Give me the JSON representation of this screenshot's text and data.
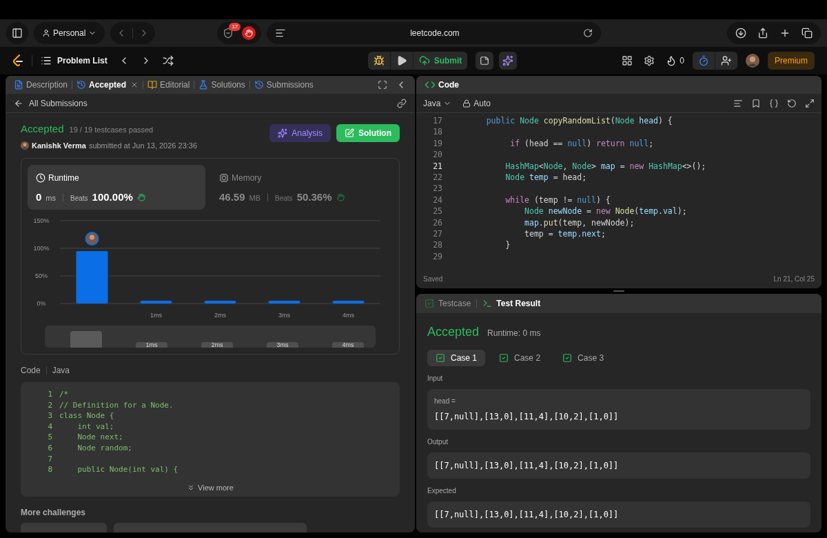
{
  "browser": {
    "profile": "Personal",
    "extension_badge": "17",
    "address": "leetcode.com"
  },
  "toolbar": {
    "problem_list": "Problem List",
    "submit": "Submit",
    "streak": "0",
    "premium": "Premium"
  },
  "left_panel": {
    "tabs": [
      {
        "label": "Description",
        "kind": "description",
        "selected": false,
        "closable": false
      },
      {
        "label": "Accepted",
        "kind": "accepted",
        "selected": true,
        "closable": true
      },
      {
        "label": "Editorial",
        "kind": "editorial",
        "selected": false,
        "closable": false
      },
      {
        "label": "Solutions",
        "kind": "solutions",
        "selected": false,
        "closable": false
      },
      {
        "label": "Submissions",
        "kind": "submissions",
        "selected": false,
        "closable": false
      }
    ],
    "back_link": "All Submissions",
    "result": {
      "status": "Accepted",
      "passed": "19 / 19 testcases passed",
      "author": "Kanishk Verma",
      "submitted": "submitted at Jun 13, 2026 23:36",
      "buttons": [
        {
          "label": "Analysis",
          "kind": "analysis"
        },
        {
          "label": "Solution",
          "kind": "solution"
        }
      ]
    },
    "stats": [
      {
        "kind": "runtime",
        "label": "Runtime",
        "value": "0",
        "unit": "ms",
        "beats_label": "Beats",
        "beats": "100.00%",
        "selected": true
      },
      {
        "kind": "memory",
        "label": "Memory",
        "value": "46.59",
        "unit": "MB",
        "beats_label": "Beats",
        "beats": "50.36%",
        "selected": false
      }
    ],
    "chart_data": {
      "type": "bar",
      "x": [
        0,
        1,
        2,
        3,
        4
      ],
      "values": [
        95,
        5,
        5,
        5,
        5
      ],
      "xlim": [
        -0.5,
        4.5
      ],
      "ylim": [
        0,
        150
      ],
      "yticks": [
        {
          "value": 0,
          "label": "0%"
        },
        {
          "value": 50,
          "label": "50%"
        },
        {
          "value": 100,
          "label": "100%"
        },
        {
          "value": 150,
          "label": "150%"
        }
      ],
      "xticks": [
        {
          "value": 1,
          "label": "1ms"
        },
        {
          "value": 2,
          "label": "2ms"
        },
        {
          "value": 3,
          "label": "3ms"
        },
        {
          "value": 4,
          "label": "4ms"
        }
      ]
    },
    "overview_labels": [
      "1ms",
      "2ms",
      "3ms",
      "4ms"
    ],
    "code_heading": "Code",
    "code_language": "Java",
    "code_lines": [
      {
        "number": "1",
        "text": "/*"
      },
      {
        "number": "2",
        "text": "// Definition for a Node."
      },
      {
        "number": "3",
        "text": "class Node {"
      },
      {
        "number": "4",
        "text": "    int val;"
      },
      {
        "number": "5",
        "text": "    Node next;"
      },
      {
        "number": "6",
        "text": "    Node random;"
      },
      {
        "number": "7"
      },
      {
        "number": "8",
        "text": "    public Node(int val) {"
      }
    ],
    "view_more": "View more",
    "more_challenges": "More challenges"
  },
  "editor": {
    "title": "Code",
    "language": "Java",
    "mode": "Auto",
    "lines": [
      {
        "number": "17",
        "current": false,
        "tokens": [
          {
            "text": "    public ",
            "kind": "lit"
          },
          {
            "text": "Node ",
            "kind": "type"
          },
          {
            "text": "copyRandomList",
            "kind": "fn"
          },
          {
            "text": "(",
            "kind": "plain"
          },
          {
            "text": "Node ",
            "kind": "type"
          },
          {
            "text": "head",
            "kind": "var"
          },
          {
            "text": ") {",
            "kind": "plain"
          }
        ]
      },
      {
        "number": "18",
        "current": false
      },
      {
        "number": "19",
        "current": false,
        "tokens": [
          {
            "text": "         if",
            "kind": "kw"
          },
          {
            "text": " (head == ",
            "kind": "plain"
          },
          {
            "text": "null",
            "kind": "lit"
          },
          {
            "text": ") ",
            "kind": "plain"
          },
          {
            "text": "return ",
            "kind": "kw"
          },
          {
            "text": "null",
            "kind": "lit"
          },
          {
            "text": ";",
            "kind": "plain"
          }
        ]
      },
      {
        "number": "20",
        "current": false
      },
      {
        "number": "21",
        "current": true,
        "tokens": [
          {
            "text": "        HashMap",
            "kind": "type"
          },
          {
            "text": "<",
            "kind": "plain"
          },
          {
            "text": "Node",
            "kind": "type"
          },
          {
            "text": ", ",
            "kind": "plain"
          },
          {
            "text": "Node",
            "kind": "type"
          },
          {
            "text": "> ",
            "kind": "plain"
          },
          {
            "text": "map",
            "kind": "var"
          },
          {
            "text": " = ",
            "kind": "plain"
          },
          {
            "text": "new ",
            "kind": "kw"
          },
          {
            "text": "HashMap",
            "kind": "type"
          },
          {
            "text": "<>();",
            "kind": "plain"
          }
        ]
      },
      {
        "number": "22",
        "current": false,
        "tokens": [
          {
            "text": "        Node ",
            "kind": "type"
          },
          {
            "text": "temp",
            "kind": "var"
          },
          {
            "text": " = head;",
            "kind": "plain"
          }
        ]
      },
      {
        "number": "23",
        "current": false
      },
      {
        "number": "24",
        "current": false,
        "tokens": [
          {
            "text": "        while",
            "kind": "kw"
          },
          {
            "text": " (temp != ",
            "kind": "plain"
          },
          {
            "text": "null",
            "kind": "lit"
          },
          {
            "text": ") {",
            "kind": "plain"
          }
        ]
      },
      {
        "number": "25",
        "current": false,
        "tokens": [
          {
            "text": "            Node ",
            "kind": "type"
          },
          {
            "text": "newNode",
            "kind": "var"
          },
          {
            "text": " = ",
            "kind": "plain"
          },
          {
            "text": "new ",
            "kind": "kw"
          },
          {
            "text": "Node",
            "kind": "fn"
          },
          {
            "text": "(",
            "kind": "plain"
          },
          {
            "text": "temp",
            "kind": "var"
          },
          {
            "text": ".",
            "kind": "plain"
          },
          {
            "text": "val",
            "kind": "var"
          },
          {
            "text": ");",
            "kind": "plain"
          }
        ]
      },
      {
        "number": "26",
        "current": false,
        "tokens": [
          {
            "text": "            map",
            "kind": "var"
          },
          {
            "text": ".",
            "kind": "plain"
          },
          {
            "text": "put",
            "kind": "fn"
          },
          {
            "text": "(temp, newNode);",
            "kind": "plain"
          }
        ]
      },
      {
        "number": "27",
        "current": false,
        "tokens": [
          {
            "text": "            temp = ",
            "kind": "plain"
          },
          {
            "text": "temp",
            "kind": "var"
          },
          {
            "text": ".",
            "kind": "plain"
          },
          {
            "text": "next",
            "kind": "var"
          },
          {
            "text": ";",
            "kind": "plain"
          }
        ]
      },
      {
        "number": "28",
        "current": false,
        "tokens": [
          {
            "text": "        }",
            "kind": "plain"
          }
        ]
      },
      {
        "number": "29",
        "current": false
      }
    ],
    "status": "Saved",
    "cursor": "Ln 21, Col 25"
  },
  "test_panel": {
    "tabs": [
      {
        "label": "Testcase",
        "selected": false
      },
      {
        "label": "Test Result",
        "selected": true
      }
    ],
    "status": "Accepted",
    "runtime": "Runtime: 0 ms",
    "cases": [
      {
        "label": "Case 1",
        "selected": true,
        "passed": true
      },
      {
        "label": "Case 2",
        "selected": false,
        "passed": true
      },
      {
        "label": "Case 3",
        "selected": false,
        "passed": true
      }
    ],
    "sections": [
      {
        "label": "Input",
        "param": "head =",
        "value": "[[7,null],[13,0],[11,4],[10,2],[1,0]]"
      },
      {
        "label": "Output",
        "value": "[[7,null],[13,0],[11,4],[10,2],[1,0]]"
      },
      {
        "label": "Expected",
        "value": "[[7,null],[13,0],[11,4],[10,2],[1,0]]"
      }
    ]
  }
}
